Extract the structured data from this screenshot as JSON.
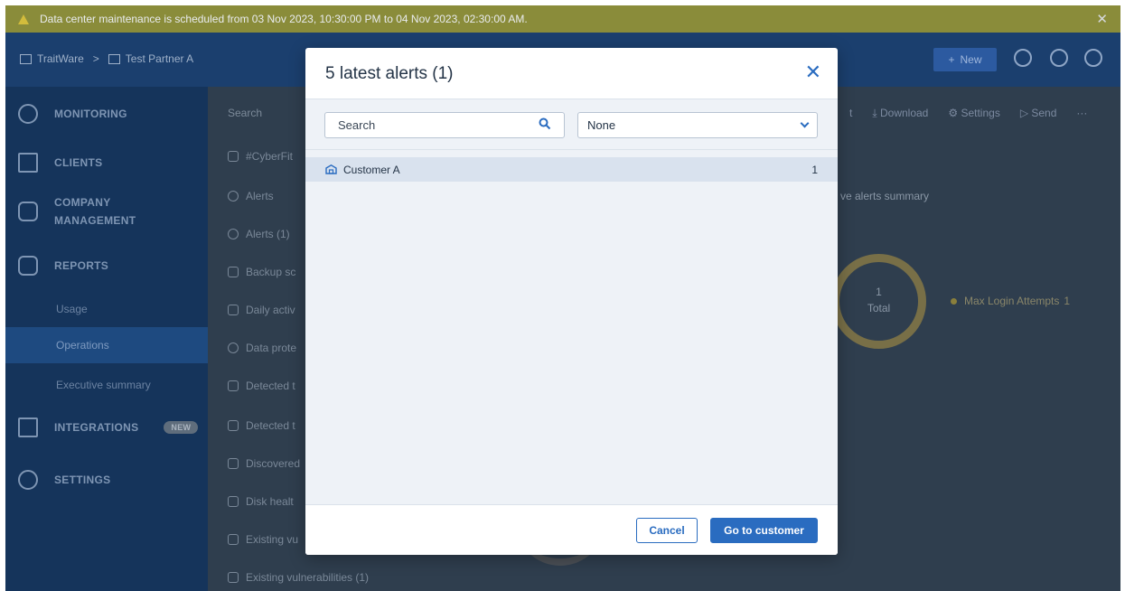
{
  "banner": {
    "message": "Data center maintenance is scheduled from 03 Nov 2023, 10:30:00 PM to 04 Nov 2023, 02:30:00 AM.",
    "close": "✕"
  },
  "topnav": {
    "crumbs": [
      "TraitWare",
      "Test Partner A"
    ],
    "separator": ">",
    "new_label": "New"
  },
  "sidebar": {
    "monitoring": "MONITORING",
    "clients": "CLIENTS",
    "company_management": [
      "COMPANY",
      "MANAGEMENT"
    ],
    "reports": "REPORTS",
    "reports_sub": [
      "Usage",
      "Operations",
      "Executive summary"
    ],
    "active_sub": "Operations",
    "integrations": "INTEGRATIONS",
    "integrations_badge": "NEW",
    "settings": "SETTINGS"
  },
  "main": {
    "search_label": "Search",
    "reports": [
      "#CyberFit",
      "Alerts",
      "Alerts (1)",
      "Backup sc",
      "Daily activ",
      "Data prote",
      "Detected t",
      "Detected t",
      "Discovered",
      "Disk healt",
      "Existing vu",
      "Existing vulnerabilities (1)"
    ],
    "toolbar": [
      "t",
      "Download",
      "Settings",
      "Send",
      "···"
    ],
    "summary_title": "ve alerts summary",
    "total_value": "1",
    "total_label": "Total",
    "legend_label": "Max Login Attempts",
    "legend_value": "1"
  },
  "modal": {
    "title": "5 latest alerts (1)",
    "close": "✕",
    "search_placeholder": "Search",
    "filter_value": "None",
    "rows": [
      {
        "name": "Customer A",
        "count": "1"
      }
    ],
    "cancel_label": "Cancel",
    "go_label": "Go to customer"
  },
  "colors": {
    "accent": "#2a6cc0",
    "sidebar": "#15345b",
    "banner": "#8a8c3a"
  }
}
